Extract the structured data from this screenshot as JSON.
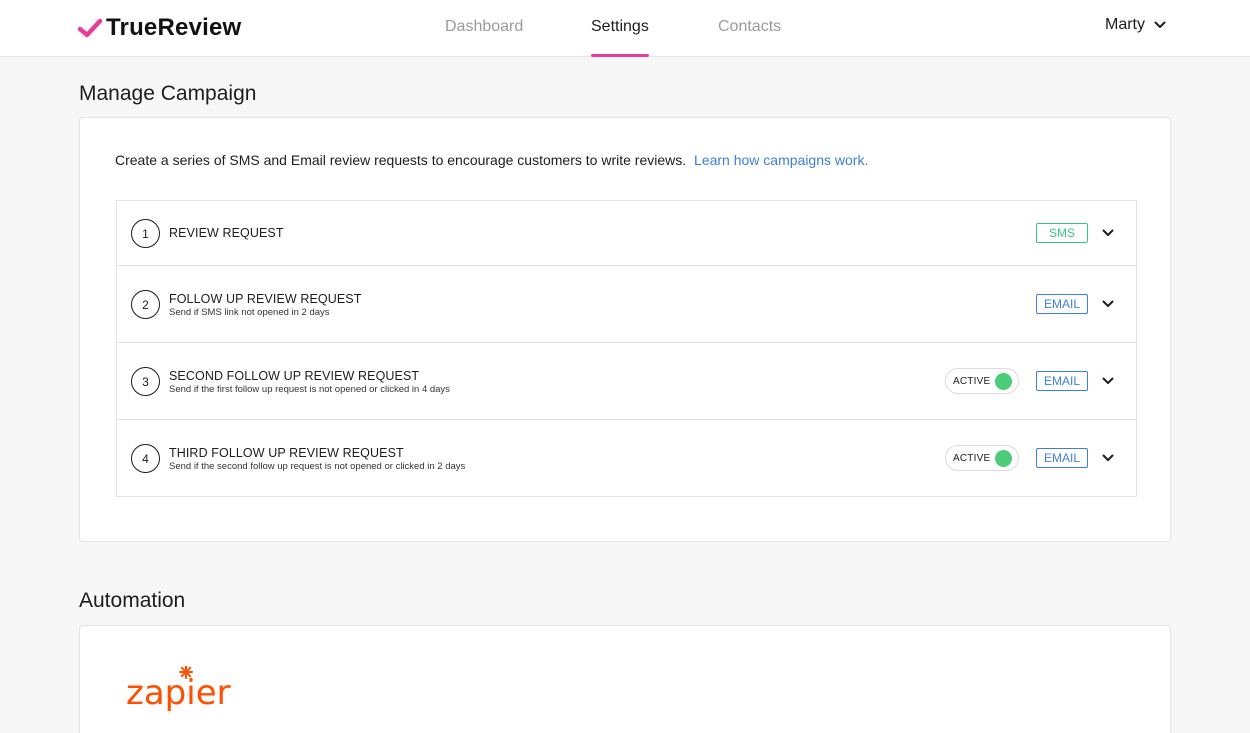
{
  "brand": {
    "name": "TrueReview",
    "accent": "#e83e9a"
  },
  "nav": {
    "items": [
      "Dashboard",
      "Settings",
      "Contacts"
    ],
    "active": "Settings"
  },
  "user": {
    "name": "Marty"
  },
  "campaign": {
    "title": "Manage Campaign",
    "intro": "Create a series of SMS and Email review requests to encourage customers to write reviews.",
    "link": "Learn how campaigns work.",
    "steps": [
      {
        "number": "1",
        "title": "REVIEW REQUEST",
        "subtitle": "",
        "channel": "SMS",
        "status": ""
      },
      {
        "number": "2",
        "title": "FOLLOW UP REVIEW REQUEST",
        "subtitle": "Send if SMS link not opened in 2 days",
        "channel": "EMAIL",
        "status": ""
      },
      {
        "number": "3",
        "title": "SECOND FOLLOW UP REVIEW REQUEST",
        "subtitle": "Send if the first follow up request is not opened or clicked in 4 days",
        "channel": "EMAIL",
        "status": "ACTIVE"
      },
      {
        "number": "4",
        "title": "THIRD FOLLOW UP REVIEW REQUEST",
        "subtitle": "Send if the second follow up request is not opened or clicked in 2 days",
        "channel": "EMAIL",
        "status": "ACTIVE"
      }
    ]
  },
  "automation": {
    "title": "Automation",
    "logo_text": "zapier",
    "logo_color": "#ff4f00"
  },
  "colors": {
    "sms": "#3cc47c",
    "email": "#3e7fd8",
    "toggle_on": "#4dcc79"
  }
}
